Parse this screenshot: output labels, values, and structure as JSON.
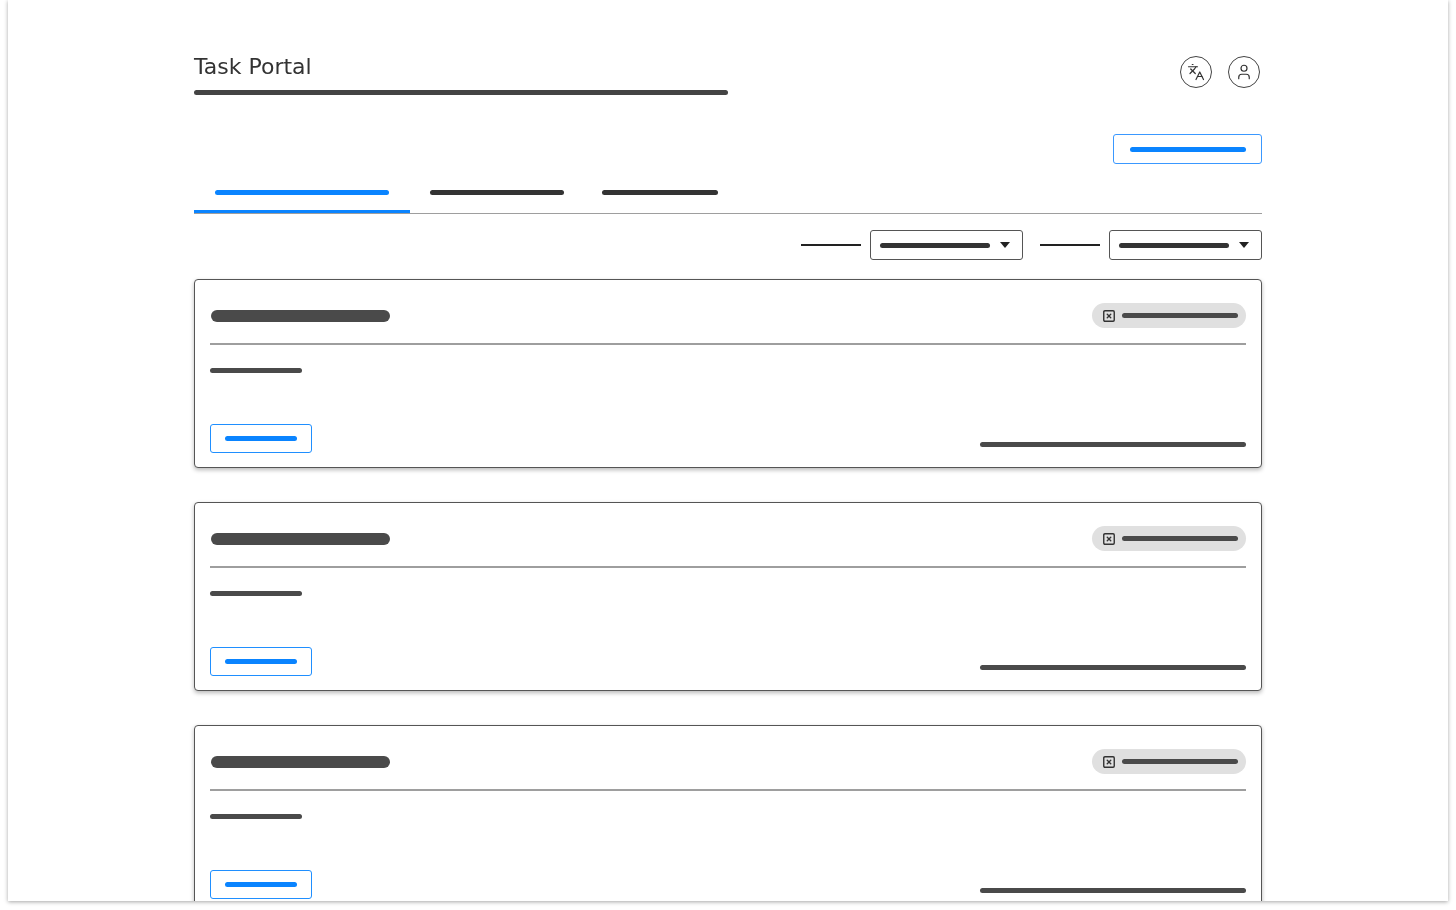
{
  "header": {
    "title": "Task Portal"
  },
  "actions": [
    {
      "kind": "button"
    }
  ],
  "tabs": [
    {
      "selected": true
    },
    {
      "selected": false
    },
    {
      "selected": false
    }
  ],
  "filters": [
    {
      "kind": "dropdown"
    },
    {
      "kind": "dropdown"
    }
  ],
  "cards": [
    {
      "kind": "task"
    },
    {
      "kind": "task"
    },
    {
      "kind": "task"
    }
  ]
}
